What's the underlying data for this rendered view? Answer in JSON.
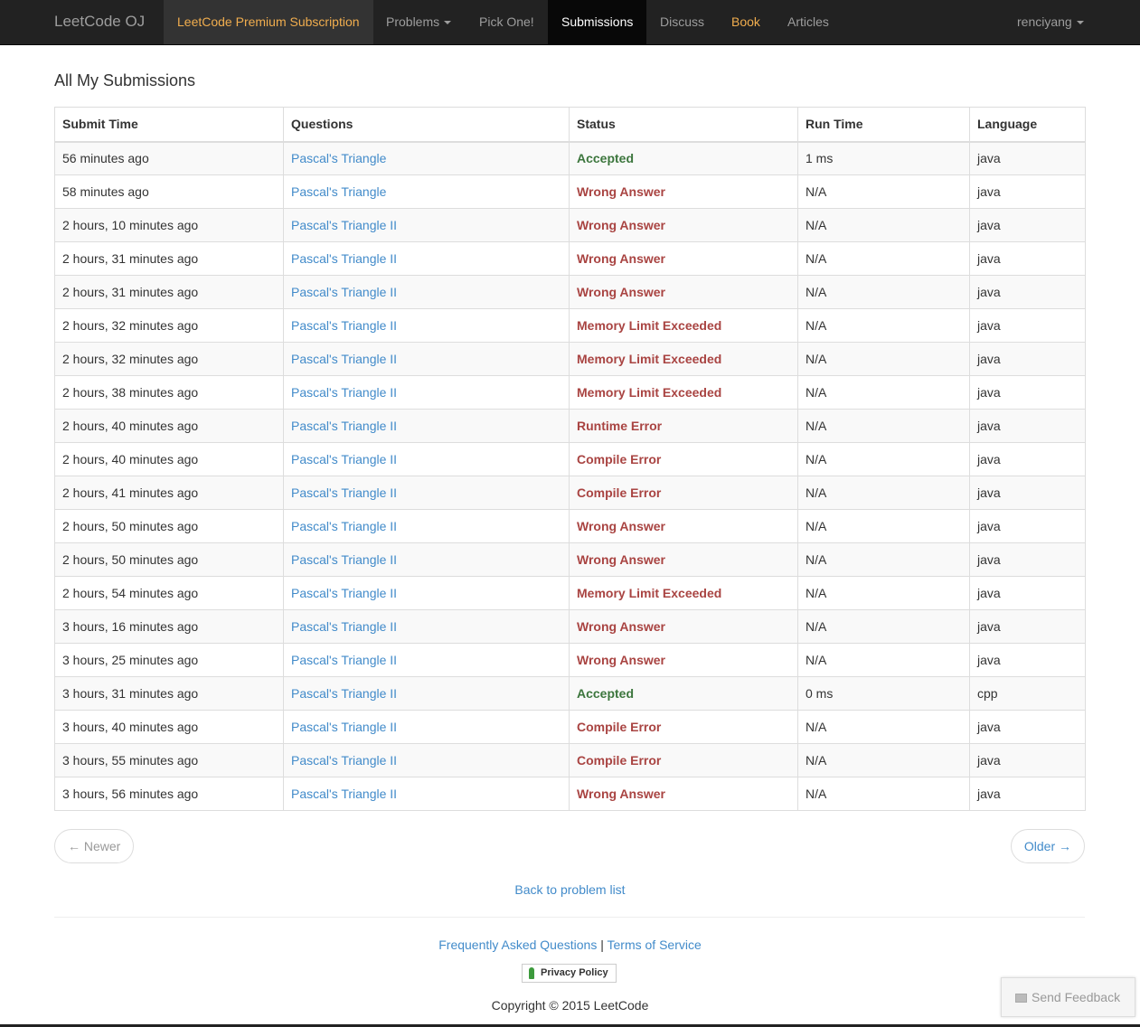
{
  "navbar": {
    "brand": "LeetCode OJ",
    "items": [
      {
        "label": "LeetCode Premium Subscription"
      },
      {
        "label": "Problems"
      },
      {
        "label": "Pick One!"
      },
      {
        "label": "Submissions"
      },
      {
        "label": "Discuss"
      },
      {
        "label": "Book"
      },
      {
        "label": "Articles"
      }
    ],
    "user": "renciyang"
  },
  "page": {
    "title": "All My Submissions"
  },
  "table": {
    "headers": [
      "Submit Time",
      "Questions",
      "Status",
      "Run Time",
      "Language"
    ],
    "rows": [
      {
        "time": "56 minutes ago",
        "question": "Pascal's Triangle",
        "status": "Accepted",
        "runtime": "1 ms",
        "language": "java"
      },
      {
        "time": "58 minutes ago",
        "question": "Pascal's Triangle",
        "status": "Wrong Answer",
        "runtime": "N/A",
        "language": "java"
      },
      {
        "time": "2 hours, 10 minutes ago",
        "question": "Pascal's Triangle II",
        "status": "Wrong Answer",
        "runtime": "N/A",
        "language": "java"
      },
      {
        "time": "2 hours, 31 minutes ago",
        "question": "Pascal's Triangle II",
        "status": "Wrong Answer",
        "runtime": "N/A",
        "language": "java"
      },
      {
        "time": "2 hours, 31 minutes ago",
        "question": "Pascal's Triangle II",
        "status": "Wrong Answer",
        "runtime": "N/A",
        "language": "java"
      },
      {
        "time": "2 hours, 32 minutes ago",
        "question": "Pascal's Triangle II",
        "status": "Memory Limit Exceeded",
        "runtime": "N/A",
        "language": "java"
      },
      {
        "time": "2 hours, 32 minutes ago",
        "question": "Pascal's Triangle II",
        "status": "Memory Limit Exceeded",
        "runtime": "N/A",
        "language": "java"
      },
      {
        "time": "2 hours, 38 minutes ago",
        "question": "Pascal's Triangle II",
        "status": "Memory Limit Exceeded",
        "runtime": "N/A",
        "language": "java"
      },
      {
        "time": "2 hours, 40 minutes ago",
        "question": "Pascal's Triangle II",
        "status": "Runtime Error",
        "runtime": "N/A",
        "language": "java"
      },
      {
        "time": "2 hours, 40 minutes ago",
        "question": "Pascal's Triangle II",
        "status": "Compile Error",
        "runtime": "N/A",
        "language": "java"
      },
      {
        "time": "2 hours, 41 minutes ago",
        "question": "Pascal's Triangle II",
        "status": "Compile Error",
        "runtime": "N/A",
        "language": "java"
      },
      {
        "time": "2 hours, 50 minutes ago",
        "question": "Pascal's Triangle II",
        "status": "Wrong Answer",
        "runtime": "N/A",
        "language": "java"
      },
      {
        "time": "2 hours, 50 minutes ago",
        "question": "Pascal's Triangle II",
        "status": "Wrong Answer",
        "runtime": "N/A",
        "language": "java"
      },
      {
        "time": "2 hours, 54 minutes ago",
        "question": "Pascal's Triangle II",
        "status": "Memory Limit Exceeded",
        "runtime": "N/A",
        "language": "java"
      },
      {
        "time": "3 hours, 16 minutes ago",
        "question": "Pascal's Triangle II",
        "status": "Wrong Answer",
        "runtime": "N/A",
        "language": "java"
      },
      {
        "time": "3 hours, 25 minutes ago",
        "question": "Pascal's Triangle II",
        "status": "Wrong Answer",
        "runtime": "N/A",
        "language": "java"
      },
      {
        "time": "3 hours, 31 minutes ago",
        "question": "Pascal's Triangle II",
        "status": "Accepted",
        "runtime": "0 ms",
        "language": "cpp"
      },
      {
        "time": "3 hours, 40 minutes ago",
        "question": "Pascal's Triangle II",
        "status": "Compile Error",
        "runtime": "N/A",
        "language": "java"
      },
      {
        "time": "3 hours, 55 minutes ago",
        "question": "Pascal's Triangle II",
        "status": "Compile Error",
        "runtime": "N/A",
        "language": "java"
      },
      {
        "time": "3 hours, 56 minutes ago",
        "question": "Pascal's Triangle II",
        "status": "Wrong Answer",
        "runtime": "N/A",
        "language": "java"
      }
    ]
  },
  "pager": {
    "newer": "← Newer",
    "older": "Older →"
  },
  "back_link": "Back to problem list",
  "footer": {
    "faq": "Frequently Asked Questions",
    "separator": "|",
    "terms": "Terms of Service",
    "privacy": "Privacy Policy",
    "copyright": "Copyright © 2015 LeetCode"
  },
  "feedback": {
    "label": "Send Feedback",
    "icon": "envelope-icon"
  },
  "colors": {
    "navbar_bg": "#222222",
    "link": "#428bca",
    "premium": "#f0ad4e",
    "accepted": "#3c763d",
    "error": "#a94442"
  }
}
